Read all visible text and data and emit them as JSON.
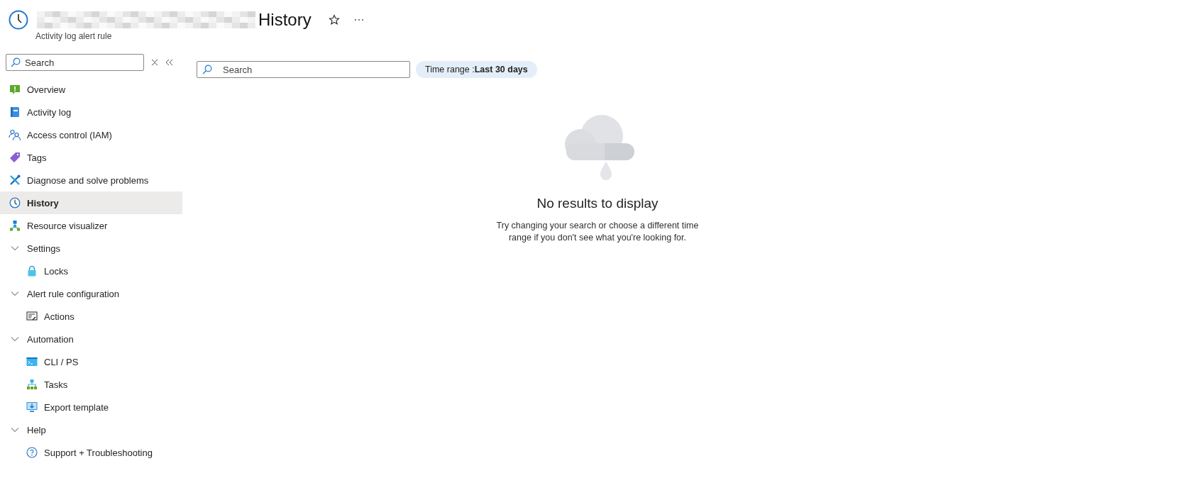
{
  "header": {
    "title": "History",
    "subtitle": "Activity log alert rule",
    "title_redacted": true
  },
  "sidebar": {
    "search": {
      "placeholder": "Search"
    },
    "items": [
      {
        "kind": "item",
        "label": "Overview",
        "selected": false
      },
      {
        "kind": "item",
        "label": "Activity log",
        "selected": false
      },
      {
        "kind": "item",
        "label": "Access control (IAM)",
        "selected": false
      },
      {
        "kind": "item",
        "label": "Tags",
        "selected": false
      },
      {
        "kind": "item",
        "label": "Diagnose and solve problems",
        "selected": false
      },
      {
        "kind": "item",
        "label": "History",
        "selected": true
      },
      {
        "kind": "item",
        "label": "Resource visualizer",
        "selected": false
      },
      {
        "kind": "group",
        "label": "Settings",
        "expanded": true,
        "children": [
          {
            "kind": "item",
            "label": "Locks",
            "selected": false
          }
        ]
      },
      {
        "kind": "group",
        "label": "Alert rule configuration",
        "expanded": true,
        "children": [
          {
            "kind": "item",
            "label": "Actions",
            "selected": false
          }
        ]
      },
      {
        "kind": "group",
        "label": "Automation",
        "expanded": true,
        "children": [
          {
            "kind": "item",
            "label": "CLI / PS",
            "selected": false
          },
          {
            "kind": "item",
            "label": "Tasks",
            "selected": false
          },
          {
            "kind": "item",
            "label": "Export template",
            "selected": false
          }
        ]
      },
      {
        "kind": "group",
        "label": "Help",
        "expanded": true,
        "children": [
          {
            "kind": "item",
            "label": "Support + Troubleshooting",
            "selected": false
          }
        ]
      }
    ]
  },
  "toolbar": {
    "search": {
      "placeholder": "Search"
    },
    "time_range": {
      "label": "Time range : ",
      "value": "Last 30 days"
    }
  },
  "empty_state": {
    "title": "No results to display",
    "message": "Try changing your search or choose a different time range if you don't see what you're looking for."
  }
}
